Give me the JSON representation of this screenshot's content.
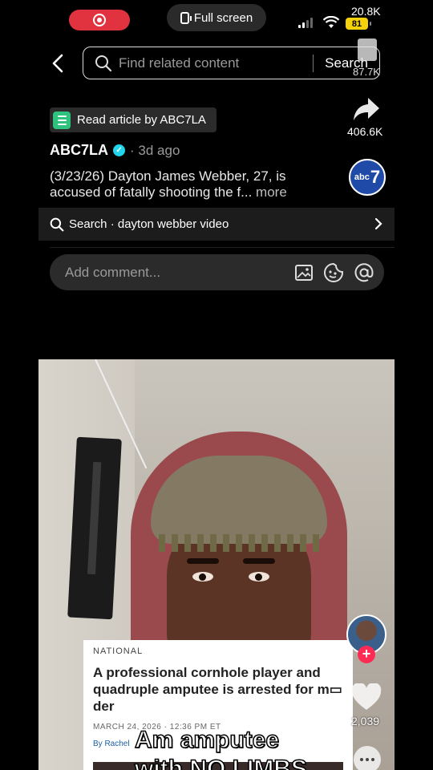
{
  "status_bar": {
    "fullscreen_label": "Full screen",
    "battery": "81",
    "count_top": "20.8K"
  },
  "search": {
    "placeholder": "Find related content",
    "button": "Search",
    "bookmark_count": "87.7K"
  },
  "article": {
    "chip_label": "Read article by ABC7LA",
    "share_count": "406.6K"
  },
  "post": {
    "author": "ABC7LA",
    "age": "· 3d ago",
    "caption": "(3/23/26) Dayton James Webber, 27, is accused of fatally shooting the f...",
    "more": " more",
    "logo_text": "abc",
    "logo_num": "7"
  },
  "suggestion": {
    "label": "Search · dayton webber video"
  },
  "comment": {
    "placeholder": "Add comment..."
  },
  "video": {
    "card": {
      "kicker": "NATIONAL",
      "headline": "A professional cornhole player and quadruple amputee is arrested for m▭ der",
      "date": "MARCH 24, 2026 · 12:36 PM ET",
      "byline": "By Rachel"
    },
    "overlay_line1": "Am amputee",
    "overlay_line2": "with NO LIMBS",
    "like_count": "2,039"
  },
  "colors": {
    "record_red": "#e0323f",
    "battery_yellow": "#f5d20a",
    "follow_red": "#fe2c55",
    "verified_cyan": "#20d5ec",
    "article_green": "#2ec27e"
  }
}
